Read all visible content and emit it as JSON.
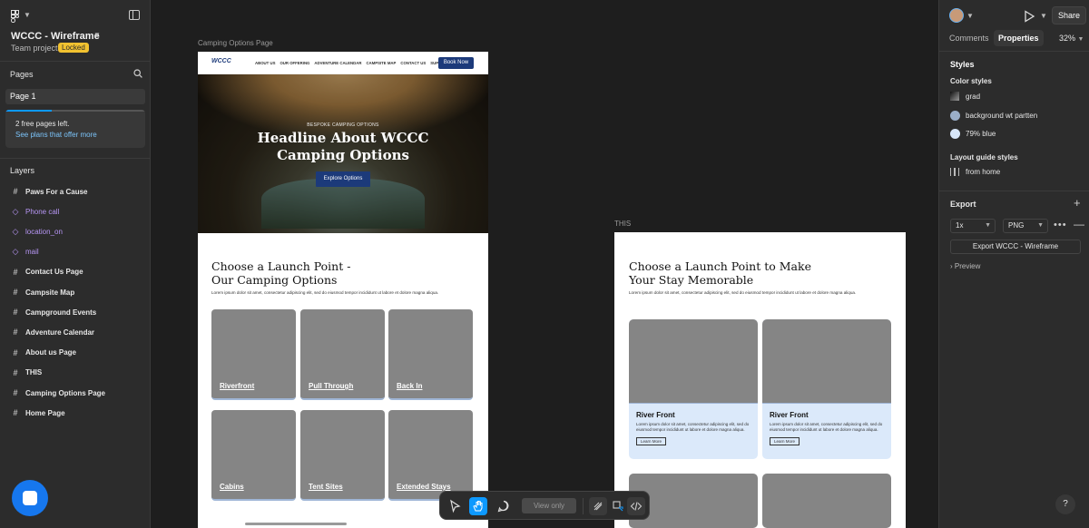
{
  "file": {
    "name": "WCCC - Wireframe",
    "team": "Team project",
    "badge": "Locked"
  },
  "pages": {
    "header": "Pages",
    "current": "Page 1",
    "notice_line1": "2 free pages left.",
    "notice_line2": "See plans that offer more",
    "used_fraction": 0.33
  },
  "layers": {
    "header": "Layers",
    "items": [
      {
        "label": "Paws For a Cause",
        "kind": "frame"
      },
      {
        "label": "Phone call",
        "kind": "component"
      },
      {
        "label": "location_on",
        "kind": "component"
      },
      {
        "label": "mail",
        "kind": "component"
      },
      {
        "label": "Contact Us Page",
        "kind": "frame"
      },
      {
        "label": "Campsite Map",
        "kind": "frame"
      },
      {
        "label": "Campground Events",
        "kind": "frame"
      },
      {
        "label": "Adventure Calendar",
        "kind": "frame"
      },
      {
        "label": "About us Page",
        "kind": "frame"
      },
      {
        "label": "THIS",
        "kind": "frame"
      },
      {
        "label": "Camping Options Page",
        "kind": "frame"
      },
      {
        "label": "Home Page",
        "kind": "frame"
      }
    ]
  },
  "right": {
    "share": "Share",
    "tabs": {
      "comments": "Comments",
      "properties": "Properties"
    },
    "zoom": "32%",
    "styles_header": "Styles",
    "color_styles_header": "Color styles",
    "color_styles": [
      {
        "name": "grad",
        "color": "gradient"
      },
      {
        "name": "background wt partten",
        "color": "#9aaec8"
      },
      {
        "name": "79% blue",
        "color": "#d7e6f8"
      }
    ],
    "layout_header": "Layout guide styles",
    "layout_styles": [
      {
        "name": "from home"
      }
    ],
    "export_header": "Export",
    "export_scale": "1x",
    "export_format": "PNG",
    "export_button": "Export WCCC - Wireframe",
    "preview": "Preview",
    "help": "?"
  },
  "canvas": {
    "frame1_label": "Camping Options Page",
    "frame2_label": "THIS",
    "nav": {
      "logo": "WCCC",
      "links": [
        "ABOUT US",
        "OUR OFFERING",
        "ADVENTURE CALENDAR",
        "CAMPSITE MAP",
        "CONTACT US",
        "SUPPORT"
      ],
      "cta": "Book Now"
    },
    "hero": {
      "eyebrow": "BESPOKE CAMPING OPTIONS",
      "title_line1": "Headline About WCCC",
      "title_line2": "Camping Options",
      "button": "Explore Options"
    },
    "section1": {
      "title_line1": "Choose a Launch Point -",
      "title_line2": "Our Camping Options",
      "subtitle": "Lorem ipsum dolor sit amet, consectetur adipiscing elit, sed do eiusmod tempor incididunt ut labore et dolore magna aliqua.",
      "cards": [
        "Riverfront",
        "Pull Through",
        "Back In",
        "Cabins",
        "Tent Sites",
        "Extended Stays"
      ]
    },
    "section2": {
      "title_line1": "Choose a Launch Point to Make",
      "title_line2": "Your Stay Memorable",
      "subtitle": "Lorem ipsum dolor sit amet, consectetur adipiscing elit, sed do eiusmod tempor incididunt ut labore et dolore magna aliqua.",
      "cards": [
        {
          "title": "River Front",
          "desc": "Lorem ipsum dolor sit amet, consectetur adipiscing elit, sed do eiusmod tempor incididunt ut labore et dolore magna aliqua.",
          "link": "Learn More"
        },
        {
          "title": "River Front",
          "desc": "Lorem ipsum dolor sit amet, consectetur adipiscing elit, sed do eiusmod tempor incididunt ut labore et dolore magna aliqua.",
          "link": "Learn More"
        }
      ]
    }
  },
  "toolbar": {
    "view_only": "View only",
    "active_tool": "hand-tool"
  },
  "colors": {
    "accent": "#0d99ff",
    "brand_navy": "#1c3a7a",
    "locked_badge": "#f2c230",
    "card_placeholder": "#858585",
    "card_tint": "#dbe9fa"
  }
}
